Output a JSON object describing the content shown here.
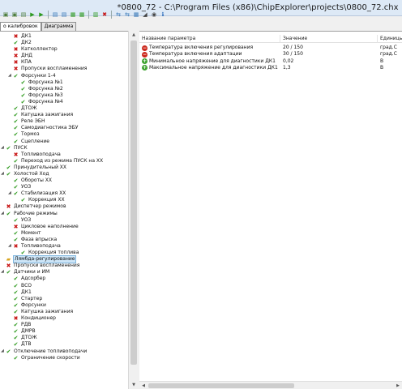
{
  "window": {
    "title": "*0800_72 - C:\\Program Files (x86)\\ChipExplorer\\projects\\0800_72.chx"
  },
  "toolbar": {
    "icons": [
      {
        "name": "new-icon",
        "glyph": "▣",
        "color": "#4e7d3a"
      },
      {
        "name": "open-icon",
        "glyph": "▣",
        "color": "#4e7d3a"
      },
      {
        "name": "save-icon",
        "glyph": "▤",
        "color": "#4e7d3a"
      },
      {
        "name": "play-icon",
        "glyph": "▶",
        "color": "#2e9a1e"
      },
      {
        "name": "tool-icon",
        "glyph": "▶",
        "color": "#2e9a1e"
      },
      {
        "name": "sep",
        "glyph": "",
        "color": ""
      },
      {
        "name": "copy-icon",
        "glyph": "▤",
        "color": "#3b7ab8"
      },
      {
        "name": "paste-icon",
        "glyph": "▤",
        "color": "#3b7ab8"
      },
      {
        "name": "compare-icon",
        "glyph": "▦",
        "color": "#2e9a1e"
      },
      {
        "name": "check-icon",
        "glyph": "▦",
        "color": "#2e9a1e"
      },
      {
        "name": "sep",
        "glyph": "",
        "color": ""
      },
      {
        "name": "scale-icon",
        "glyph": "▥",
        "color": "#2e9a1e"
      },
      {
        "name": "cancel-icon",
        "glyph": "✖",
        "color": "#c81414"
      },
      {
        "name": "sep",
        "glyph": "",
        "color": ""
      },
      {
        "name": "read-icon",
        "glyph": "⇆",
        "color": "#3b7ab8"
      },
      {
        "name": "write-icon",
        "glyph": "⇆",
        "color": "#3b7ab8"
      },
      {
        "name": "flash-icon",
        "glyph": "▦",
        "color": "#3b7ab8"
      },
      {
        "name": "signal-icon",
        "glyph": "◢",
        "color": "#444"
      },
      {
        "name": "waves-icon",
        "glyph": "◉",
        "color": "#444"
      },
      {
        "name": "info-icon",
        "glyph": "ℹ",
        "color": "#1a5fb4"
      }
    ]
  },
  "tabs": [
    {
      "label": "о калибровок",
      "active": true
    },
    {
      "label": "Диаграмма",
      "active": false
    }
  ],
  "tree": [
    {
      "label": "ДК1",
      "depth": 1,
      "icon": "red",
      "expander": ""
    },
    {
      "label": "ДК2",
      "depth": 1,
      "icon": "green",
      "expander": ""
    },
    {
      "label": "Катколлектор",
      "depth": 1,
      "icon": "red",
      "expander": ""
    },
    {
      "label": "ДНД",
      "depth": 1,
      "icon": "red",
      "expander": ""
    },
    {
      "label": "КПА",
      "depth": 1,
      "icon": "red",
      "expander": ""
    },
    {
      "label": "Пропуски воспламенения",
      "depth": 1,
      "icon": "red",
      "expander": ""
    },
    {
      "label": "Форсунки 1-4",
      "depth": 1,
      "icon": "green",
      "expander": "▲"
    },
    {
      "label": "Форсунка №1",
      "depth": 2,
      "icon": "green",
      "expander": ""
    },
    {
      "label": "Форсунка №2",
      "depth": 2,
      "icon": "green",
      "expander": ""
    },
    {
      "label": "Форсунка №3",
      "depth": 2,
      "icon": "green",
      "expander": ""
    },
    {
      "label": "Форсунка №4",
      "depth": 2,
      "icon": "green",
      "expander": ""
    },
    {
      "label": "ДТОЖ",
      "depth": 1,
      "icon": "green",
      "expander": ""
    },
    {
      "label": "Катушка зажигания",
      "depth": 1,
      "icon": "green",
      "expander": ""
    },
    {
      "label": "Реле ЭБН",
      "depth": 1,
      "icon": "green",
      "expander": ""
    },
    {
      "label": "Самодиагностика ЭБУ",
      "depth": 1,
      "icon": "green",
      "expander": ""
    },
    {
      "label": "Тормоз",
      "depth": 1,
      "icon": "green",
      "expander": ""
    },
    {
      "label": "Сцепление",
      "depth": 1,
      "icon": "green",
      "expander": ""
    },
    {
      "label": "ПУСК",
      "depth": 0,
      "icon": "green",
      "expander": "▲"
    },
    {
      "label": "Топливоподача",
      "depth": 1,
      "icon": "red",
      "expander": ""
    },
    {
      "label": "Переход из режима ПУСК на ХХ",
      "depth": 1,
      "icon": "green",
      "expander": ""
    },
    {
      "label": "Принудительный ХХ",
      "depth": 0,
      "icon": "green",
      "expander": ""
    },
    {
      "label": "Холостой Ход",
      "depth": 0,
      "icon": "green",
      "expander": "▲"
    },
    {
      "label": "Обороты ХХ",
      "depth": 1,
      "icon": "green",
      "expander": ""
    },
    {
      "label": "УОЗ",
      "depth": 1,
      "icon": "green",
      "expander": ""
    },
    {
      "label": "Стабилизация ХХ",
      "depth": 1,
      "icon": "green",
      "expander": "▲"
    },
    {
      "label": "Коррекция ХХ",
      "depth": 2,
      "icon": "green",
      "expander": ""
    },
    {
      "label": "Диспетчер режимов",
      "depth": 0,
      "icon": "red",
      "expander": ""
    },
    {
      "label": "Рабочие режимы",
      "depth": 0,
      "icon": "green",
      "expander": "▲"
    },
    {
      "label": "УОЗ",
      "depth": 1,
      "icon": "green",
      "expander": ""
    },
    {
      "label": "Цикловое наполнение",
      "depth": 1,
      "icon": "red",
      "expander": ""
    },
    {
      "label": "Момент",
      "depth": 1,
      "icon": "green",
      "expander": ""
    },
    {
      "label": "Фаза впрыска",
      "depth": 1,
      "icon": "green",
      "expander": ""
    },
    {
      "label": "Топливоподача",
      "depth": 1,
      "icon": "red",
      "expander": "▲"
    },
    {
      "label": "Коррекция топлива",
      "depth": 2,
      "icon": "green",
      "expander": ""
    },
    {
      "label": "Лямбда-регулирование",
      "depth": 0,
      "icon": "folder",
      "expander": "",
      "selected": true
    },
    {
      "label": "Пропуски воспламенения",
      "depth": 0,
      "icon": "red",
      "expander": ""
    },
    {
      "label": "Датчики и ИМ",
      "depth": 0,
      "icon": "green",
      "expander": "▲"
    },
    {
      "label": "Адсорбер",
      "depth": 1,
      "icon": "green",
      "expander": ""
    },
    {
      "label": "ВСО",
      "depth": 1,
      "icon": "green",
      "expander": ""
    },
    {
      "label": "ДК1",
      "depth": 1,
      "icon": "green",
      "expander": ""
    },
    {
      "label": "Стартер",
      "depth": 1,
      "icon": "green",
      "expander": ""
    },
    {
      "label": "Форсунки",
      "depth": 1,
      "icon": "green",
      "expander": ""
    },
    {
      "label": "Катушка зажигания",
      "depth": 1,
      "icon": "green",
      "expander": ""
    },
    {
      "label": "Кондиционер",
      "depth": 1,
      "icon": "red",
      "expander": ""
    },
    {
      "label": "РДВ",
      "depth": 1,
      "icon": "green",
      "expander": ""
    },
    {
      "label": "ДМРВ",
      "depth": 1,
      "icon": "green",
      "expander": ""
    },
    {
      "label": "ДТОЖ",
      "depth": 1,
      "icon": "green",
      "expander": ""
    },
    {
      "label": "ДТВ",
      "depth": 1,
      "icon": "green",
      "expander": ""
    },
    {
      "label": "Отключение топливоподачи",
      "depth": 0,
      "icon": "green",
      "expander": "▲"
    },
    {
      "label": "Ограничение скорости",
      "depth": 1,
      "icon": "green",
      "expander": ""
    }
  ],
  "grid": {
    "columns": [
      "Название параметра",
      "Значение",
      "Единицы и"
    ],
    "rows": [
      {
        "status": "err",
        "name": "Температура включения регулирования",
        "value": "20 / 150",
        "unit": "град.С"
      },
      {
        "status": "err",
        "name": "Температура включения адаптации",
        "value": "30 / 150",
        "unit": "град.С"
      },
      {
        "status": "ok",
        "name": "Минимальное напряжение для диагностики ДК1",
        "value": "0,02",
        "unit": "В"
      },
      {
        "status": "ok",
        "name": "Максимальное напряжение для диагностики ДК1",
        "value": "1,3",
        "unit": "В"
      }
    ]
  },
  "colors": {
    "error": "#cc2a1e",
    "ok": "#3da22f",
    "selection": "#cde5f7"
  }
}
